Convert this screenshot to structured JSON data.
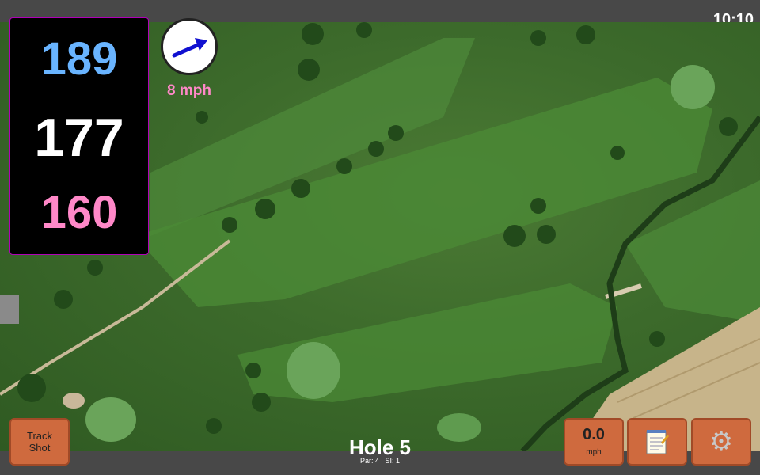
{
  "status": {
    "time": "10:10"
  },
  "yardage": {
    "back": "189",
    "middle": "177",
    "front": "160",
    "colors": {
      "back": "#69b4ff",
      "middle": "#ffffff",
      "front": "#ff88c8"
    }
  },
  "wind": {
    "speed_label": "8 mph",
    "arrow_color": "#1010d0",
    "label_color": "#ff88c8",
    "icon": "wind-direction-arrow-icon"
  },
  "buttons": {
    "track_shot_line1": "Track",
    "track_shot_line2": "Shot",
    "speed_value": "0.0",
    "speed_unit": "mph",
    "notes_icon": "notepad-icon",
    "settings_icon": "gear-icon"
  },
  "hole": {
    "title": "Hole 5",
    "par": "Par: 4",
    "si": "SI: 1"
  },
  "colors": {
    "button_bg": "#cf6a3e",
    "bar_bg": "#484848"
  }
}
